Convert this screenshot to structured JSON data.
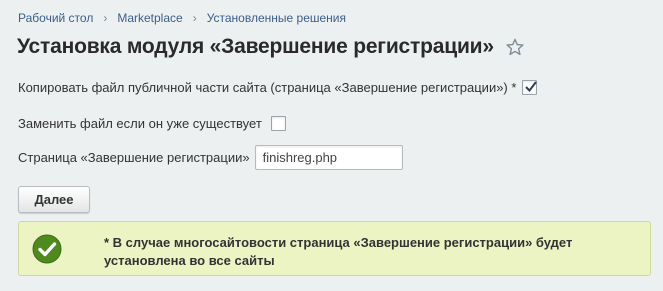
{
  "breadcrumb": {
    "items": [
      "Рабочий стол",
      "Marketplace",
      "Установленные решения"
    ]
  },
  "page": {
    "title": "Установка модуля «Завершение регистрации»"
  },
  "form": {
    "copy_public_label": "Копировать файл публичной части сайта (страница «Завершение регистрации») *",
    "copy_public_checked": true,
    "replace_existing_label": "Заменить файл если он уже существует",
    "replace_existing_checked": false,
    "page_field_label": "Страница «Завершение регистрации»",
    "page_field_value": "finishreg.php"
  },
  "actions": {
    "next_label": "Далее"
  },
  "notice": {
    "text": "* В случае многосайтовости страница «Завершение регистрации» будет установлена во все сайты",
    "icon": "check-circle-icon"
  },
  "colors": {
    "background": "#edf0f0",
    "notice_bg": "#ecf4c4",
    "success_green": "#4e8a1e",
    "link": "#3a5e8c"
  }
}
